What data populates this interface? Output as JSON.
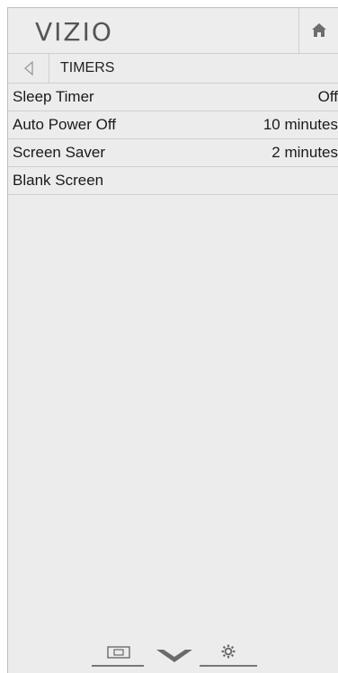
{
  "header": {
    "brand": "VIZIO",
    "home_icon": "home-icon"
  },
  "breadcrumb": {
    "back_icon": "back-triangle-icon",
    "title": "TIMERS"
  },
  "menu": {
    "items": [
      {
        "label": "Sleep Timer",
        "value": "Off"
      },
      {
        "label": "Auto Power Off",
        "value": "10 minutes"
      },
      {
        "label": "Screen Saver",
        "value": "2 minutes"
      },
      {
        "label": "Blank Screen",
        "value": ""
      }
    ]
  },
  "footer": {
    "icons": [
      "input-icon",
      "vizio-v-icon",
      "settings-gear-icon"
    ]
  },
  "colors": {
    "panel_bg": "#ececec",
    "divider": "#cfcfcf",
    "text": "#1a1a1a",
    "icon_gray": "#777777"
  }
}
